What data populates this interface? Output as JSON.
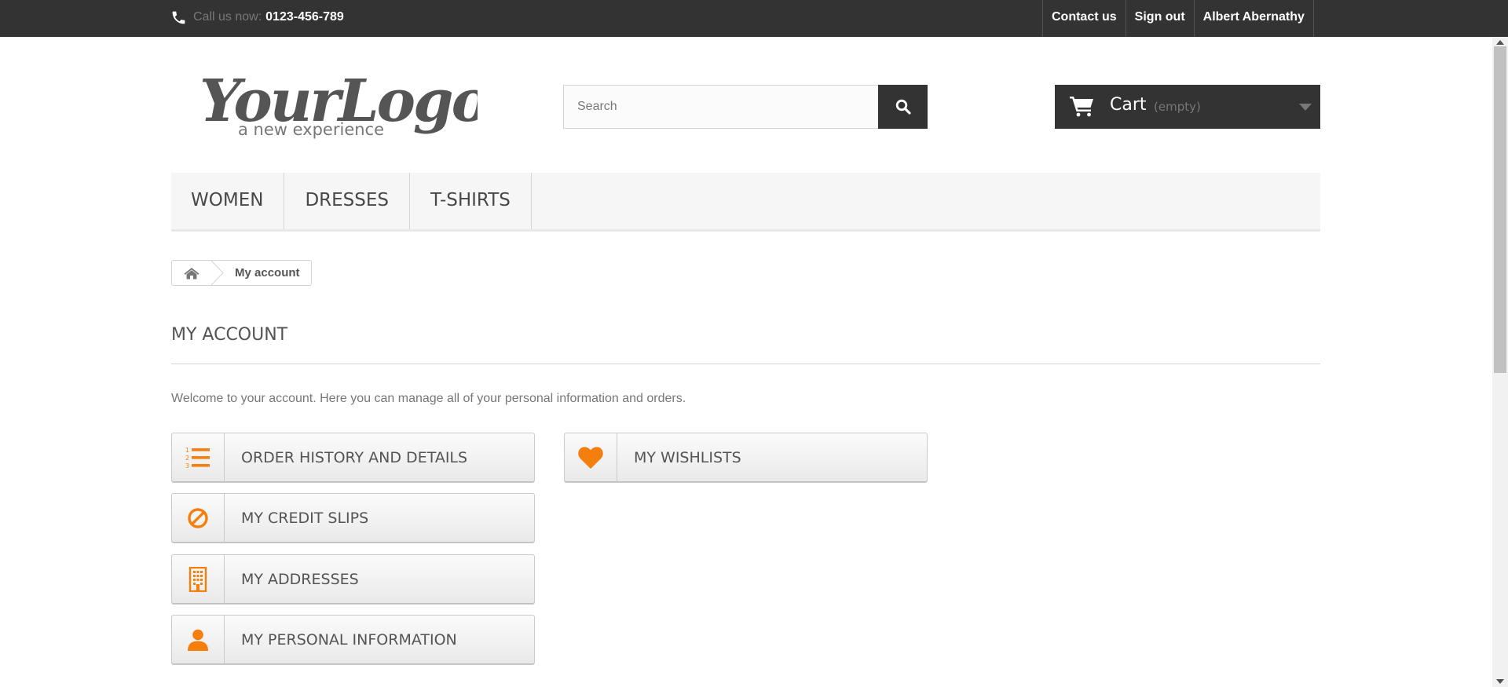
{
  "topbar": {
    "call_label": "Call us now:",
    "call_number": "0123-456-789",
    "links": [
      "Contact us",
      "Sign out",
      "Albert Abernathy"
    ]
  },
  "logo": {
    "text": "YourLogo",
    "tagline": "a new experience"
  },
  "search": {
    "placeholder": "Search",
    "value": ""
  },
  "cart": {
    "label": "Cart",
    "status": "(empty)"
  },
  "menu": {
    "items": [
      "WOMEN",
      "DRESSES",
      "T-SHIRTS"
    ]
  },
  "breadcrumb": {
    "current": "My account"
  },
  "page": {
    "title": "MY ACCOUNT",
    "welcome": "Welcome to your account. Here you can manage all of your personal information and orders."
  },
  "account_links": [
    {
      "label": "ORDER HISTORY AND DETAILS",
      "icon": "list-ol-icon"
    },
    {
      "label": "MY CREDIT SLIPS",
      "icon": "ban-icon"
    },
    {
      "label": "MY ADDRESSES",
      "icon": "building-icon"
    },
    {
      "label": "MY PERSONAL INFORMATION",
      "icon": "user-icon"
    },
    {
      "label": "MY WISHLISTS",
      "icon": "heart-icon"
    }
  ],
  "colors": {
    "topbar_bg": "#333333",
    "accent_orange": "#f47f0c",
    "menu_bg": "#f6f6f6"
  }
}
